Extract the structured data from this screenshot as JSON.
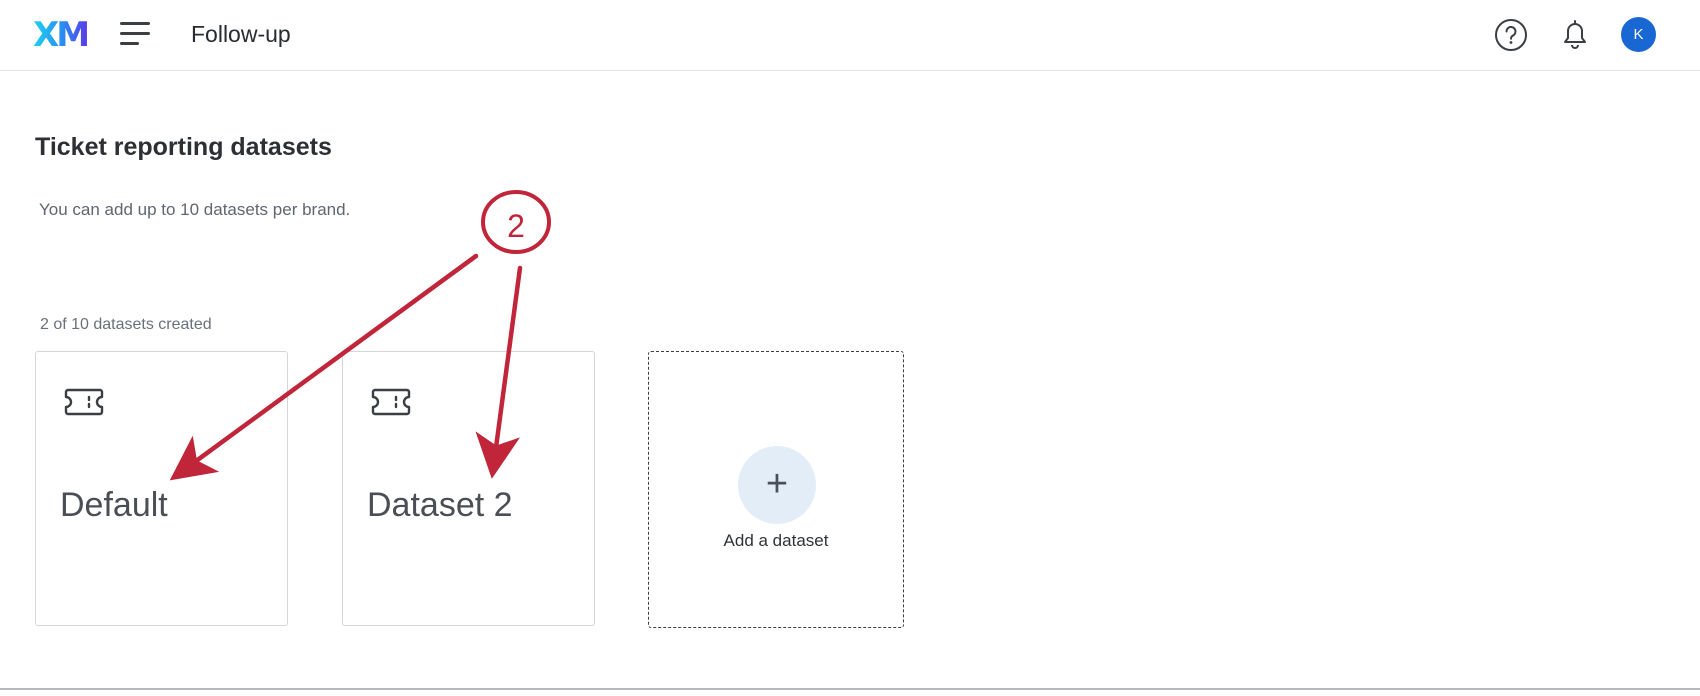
{
  "header": {
    "logo_text": "XM",
    "app_title": "Follow-up",
    "avatar_initial": "K"
  },
  "main": {
    "page_title": "Ticket reporting datasets",
    "subtitle": "You can add up to 10 datasets per brand.",
    "count_text": "2 of 10 datasets created",
    "datasets": [
      {
        "label": "Default",
        "icon": "ticket-icon"
      },
      {
        "label": "Dataset 2",
        "icon": "ticket-icon"
      }
    ],
    "add_card": {
      "plus": "+",
      "label": "Add a dataset"
    }
  },
  "annotation": {
    "number": "2",
    "color": "#c1253a"
  },
  "colors": {
    "avatar_bg": "#1967d2",
    "plus_circle_bg": "#e3edf8"
  }
}
